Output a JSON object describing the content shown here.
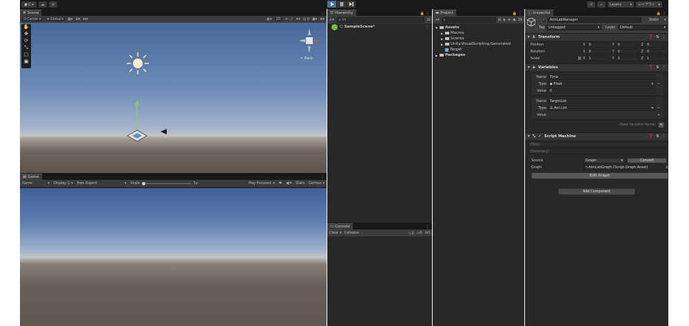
{
  "toolbar": {
    "account_label": "C",
    "layers_label": "Layers",
    "layout_label": "レイアウト"
  },
  "scene": {
    "tab_label": "Scene",
    "pivot_label": "Center",
    "space_label": "Global",
    "mode_2d": "2D",
    "gizmo_back_label": "< Back"
  },
  "game": {
    "tab_label": "Game",
    "view_label": "Game",
    "display_label": "Display 1",
    "aspect_label": "Free Aspect",
    "scale_label": "Scale",
    "scale_value": "1x",
    "play_mode_label": "Play Focused",
    "stats_label": "Stats",
    "gizmos_label": "Gizmos"
  },
  "hierarchy": {
    "tab_label": "Hierarchy",
    "search_placeholder": "All",
    "scene_item": "SampleScene*"
  },
  "project": {
    "tab_label": "Project",
    "hidden_count": "14",
    "tree": [
      {
        "label": "Assets",
        "level": 0,
        "kind": "folder-open",
        "bold": true
      },
      {
        "label": "Macros",
        "level": 1,
        "kind": "folder"
      },
      {
        "label": "Scenes",
        "level": 1,
        "kind": "folder"
      },
      {
        "label": "Unity.VisualScripting.Generated",
        "level": 1,
        "kind": "folder"
      },
      {
        "label": "Target",
        "level": 1,
        "kind": "prefab"
      },
      {
        "label": "Packages",
        "level": 0,
        "kind": "folder",
        "bold": true
      }
    ]
  },
  "console": {
    "tab_label": "Console",
    "clear_label": "Clear",
    "collapse_label": "Collapse",
    "log_count": "0",
    "warn_count": "0",
    "error_count": "0"
  },
  "inspector": {
    "tab_label": "Inspector",
    "object_name": "AimLabManager",
    "static_label": "Static",
    "tag_label": "Tag",
    "tag_value": "Untagged",
    "layer_label": "Layer",
    "layer_value": "Default",
    "transform": {
      "title": "Transform",
      "position_label": "Position",
      "rotation_label": "Rotation",
      "scale_label": "Scale",
      "position": [
        "0",
        "0",
        "0"
      ],
      "rotation": [
        "0",
        "0",
        "0"
      ],
      "scale": [
        "1",
        "1",
        "1"
      ],
      "axis_x": "X",
      "axis_y": "Y",
      "axis_z": "Z"
    },
    "variables": {
      "title": "Variables",
      "name_label": "Name",
      "type_label": "Type",
      "value_label": "Value",
      "items": [
        {
          "name": "Time",
          "type": "Float",
          "value": "0"
        },
        {
          "name": "TargetList",
          "type": "Aot List",
          "value": ""
        }
      ],
      "new_variable_placeholder": "(New Variable Name)"
    },
    "script_machine": {
      "title": "Script Machine",
      "title_placeholder": "(Title)",
      "summary_placeholder": "(Summary)",
      "source_label": "Source",
      "source_value": "Graph",
      "convert_label": "Convert",
      "graph_label": "Graph",
      "graph_value": "AimLabGraph (Script Graph Asset)",
      "edit_graph_label": "Edit Graph"
    },
    "add_component_label": "Add Component"
  }
}
